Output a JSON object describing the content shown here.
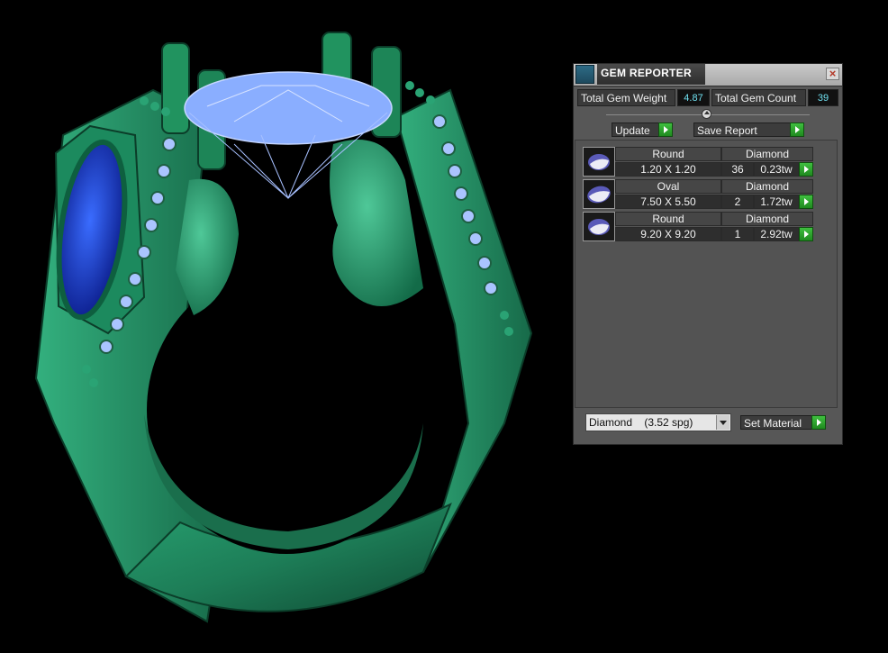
{
  "panel": {
    "title": "GEM REPORTER",
    "total_weight_label": "Total Gem Weight",
    "total_weight_value": "4.87",
    "total_count_label": "Total Gem Count",
    "total_count_value": "39",
    "update_label": "Update",
    "save_report_label": "Save Report",
    "gems": [
      {
        "shape": "Round",
        "material": "Diamond",
        "size": "1.20 X 1.20",
        "count": "36",
        "weight": "0.23tw"
      },
      {
        "shape": "Oval",
        "material": "Diamond",
        "size": "7.50 X 5.50",
        "count": "2",
        "weight": "1.72tw"
      },
      {
        "shape": "Round",
        "material": "Diamond",
        "size": "9.20 X 9.20",
        "count": "1",
        "weight": "2.92tw"
      }
    ],
    "material_select": {
      "name": "Diamond",
      "spg": "(3.52 spg)"
    },
    "set_material_label": "Set Material"
  },
  "colors": {
    "ring_green": "#1f7a55",
    "gem_blue": "#1e4fd8",
    "gem_lightblue": "#8ab0ff",
    "panel_bg": "#575757",
    "accent_green": "#2eaa2e",
    "value_cyan": "#6fe0f0"
  }
}
